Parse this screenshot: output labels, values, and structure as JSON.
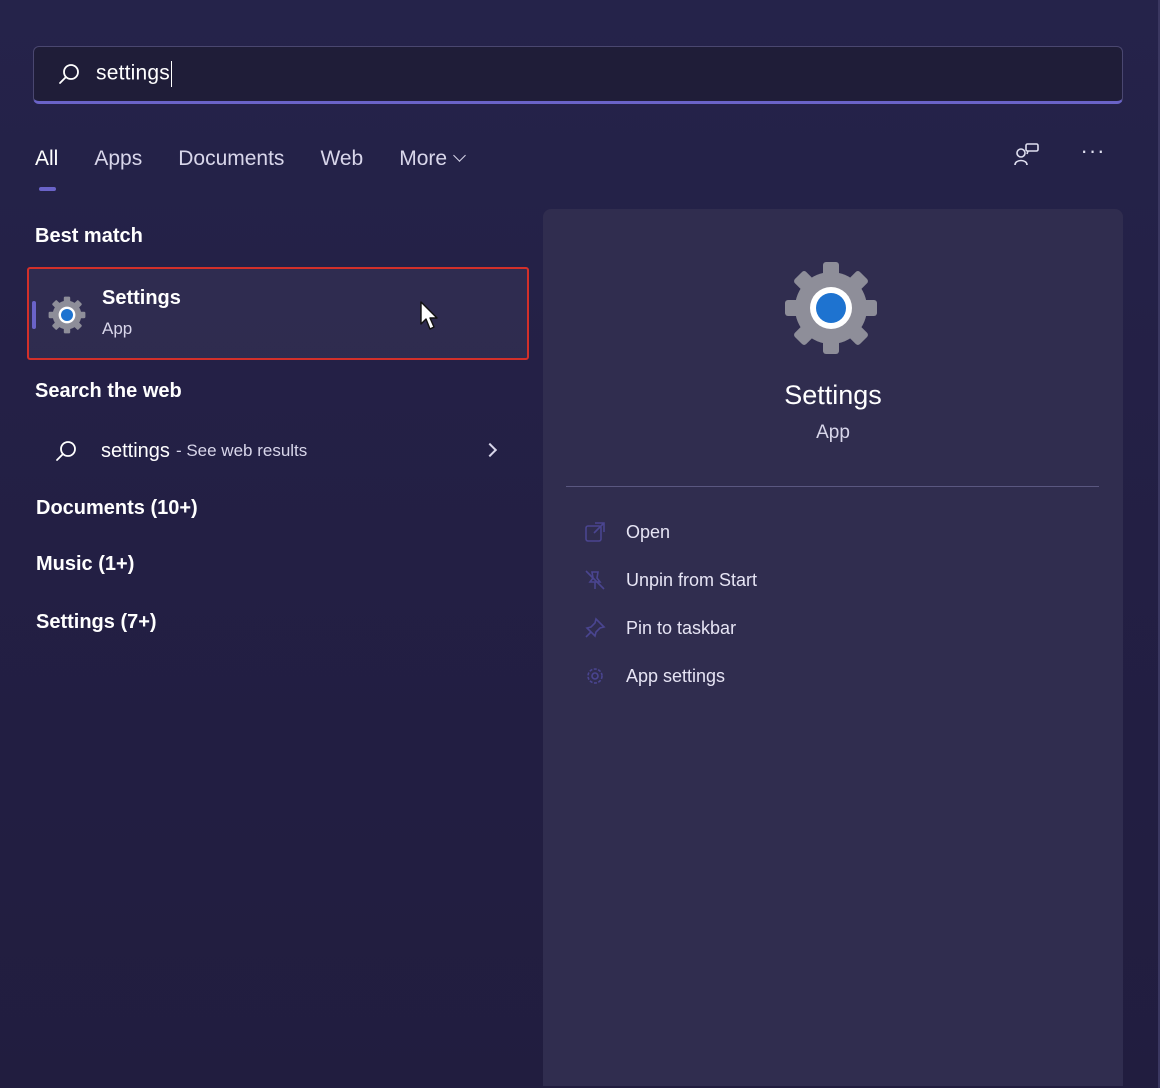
{
  "search": {
    "query": "settings"
  },
  "tabs": [
    {
      "label": "All",
      "active": true
    },
    {
      "label": "Apps"
    },
    {
      "label": "Documents"
    },
    {
      "label": "Web"
    },
    {
      "label": "More"
    }
  ],
  "left": {
    "best_match_title": "Best match",
    "best_match": {
      "name": "Settings",
      "type": "App"
    },
    "web_title": "Search the web",
    "web_result": {
      "query": "settings",
      "hint": "- See web results"
    },
    "groups": [
      {
        "label": "Documents (10+)"
      },
      {
        "label": "Music (1+)"
      },
      {
        "label": "Settings (7+)"
      }
    ]
  },
  "detail": {
    "title": "Settings",
    "subtitle": "App",
    "actions": [
      {
        "label": "Open",
        "icon": "open-external-icon"
      },
      {
        "label": "Unpin from Start",
        "icon": "unpin-icon"
      },
      {
        "label": "Pin to taskbar",
        "icon": "pin-icon"
      },
      {
        "label": "App settings",
        "icon": "gear-icon"
      }
    ]
  },
  "colors": {
    "accent": "#6a63c8",
    "highlight_border": "#d3302a",
    "gear_blue": "#1e73d0"
  }
}
